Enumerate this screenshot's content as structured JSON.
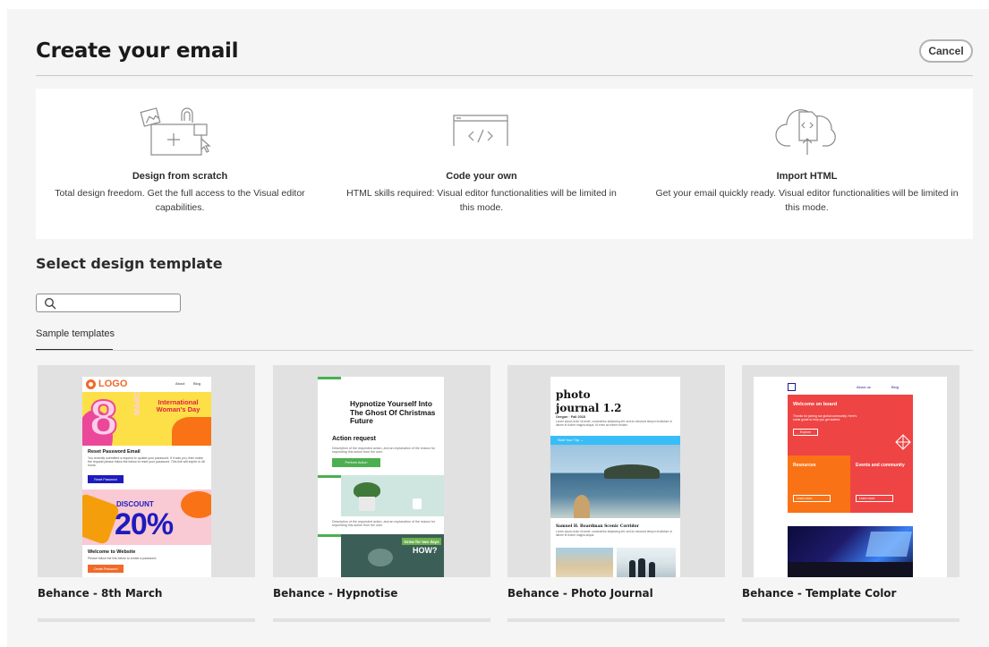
{
  "header": {
    "title": "Create your email",
    "cancel_label": "Cancel"
  },
  "options": [
    {
      "title": "Design from scratch",
      "description": "Total design freedom. Get the full access to the Visual editor capabilities.",
      "icon": "design-canvas-icon"
    },
    {
      "title": "Code your own",
      "description": "HTML skills required: Visual editor functionalities will be limited in this mode.",
      "icon": "code-browser-icon"
    },
    {
      "title": "Import HTML",
      "description": "Get your email quickly ready. Visual editor functionalities will be limited in this mode.",
      "icon": "cloud-upload-icon"
    }
  ],
  "templates_section": {
    "title": "Select design template",
    "search_placeholder": "",
    "search_icon": "search-icon",
    "tab_label": "Sample templates"
  },
  "templates": [
    {
      "name": "Behance - 8th March",
      "preview": {
        "logo": "LOGO",
        "nav": [
          "About",
          "Blog"
        ],
        "big_number": "8",
        "vertical_word": "MARCH",
        "headline": "International Woman's Day",
        "section1_title": "Reset Password Email",
        "section1_text": "You recently submitted a request to update your password. If it was you, then make the request please follow the below to reset your password. This link will expire in 48 hours.",
        "section1_button": "Reset Password",
        "discount_word": "DISCOUNT",
        "discount_value": "20%",
        "section2_title": "Welcome to Website",
        "section2_text": "Please follow the link below to create a password.",
        "section2_button": "Create Password"
      }
    },
    {
      "name": "Behance - Hypnotise",
      "preview": {
        "headline": "Hypnotize Yourself Into The Ghost Of Christmas Future",
        "section_title": "Action request",
        "section_text": "Description of the requested action, and an explanation of the reason for requesting this action from the user.",
        "button": "Perform Action",
        "text2": "Description of the requested action, and an explanation of the reason for requesting this action from the user.",
        "banner_line1": "Grow for two days",
        "banner_line2": "HOW?"
      }
    },
    {
      "name": "Behance - Photo Journal",
      "preview": {
        "title_line1": "photo",
        "title_line2": "journal 1.2",
        "subtitle": "Oregon · Fall 2018",
        "intro": "Lorem ipsum dolor sit amet, consectetur adipiscing elit, sed do eiusmod tempor incididunt ut labore et dolore magna aliqua. Ut enim ad minim veniam.",
        "bar_label": "Start Your Trip →",
        "caption_title": "Samuel H. Boardman Scenic Corridor",
        "caption_text": "Lorem ipsum dolor sit amet, consectetur adipiscing elit, sed do eiusmod tempor incididunt ut labore et dolore magna aliqua."
      }
    },
    {
      "name": "Behance - Template Color",
      "preview": {
        "nav": [
          "About us",
          "Blog"
        ],
        "welcome_title": "Welcome on board",
        "welcome_text": "Thanks for joining our global community. Here's some guide to help you get started.",
        "welcome_button": "Explore",
        "left_title": "Resources",
        "right_title": "Events and community",
        "left_button": "Learn more",
        "right_button": "Learn more"
      }
    }
  ]
}
